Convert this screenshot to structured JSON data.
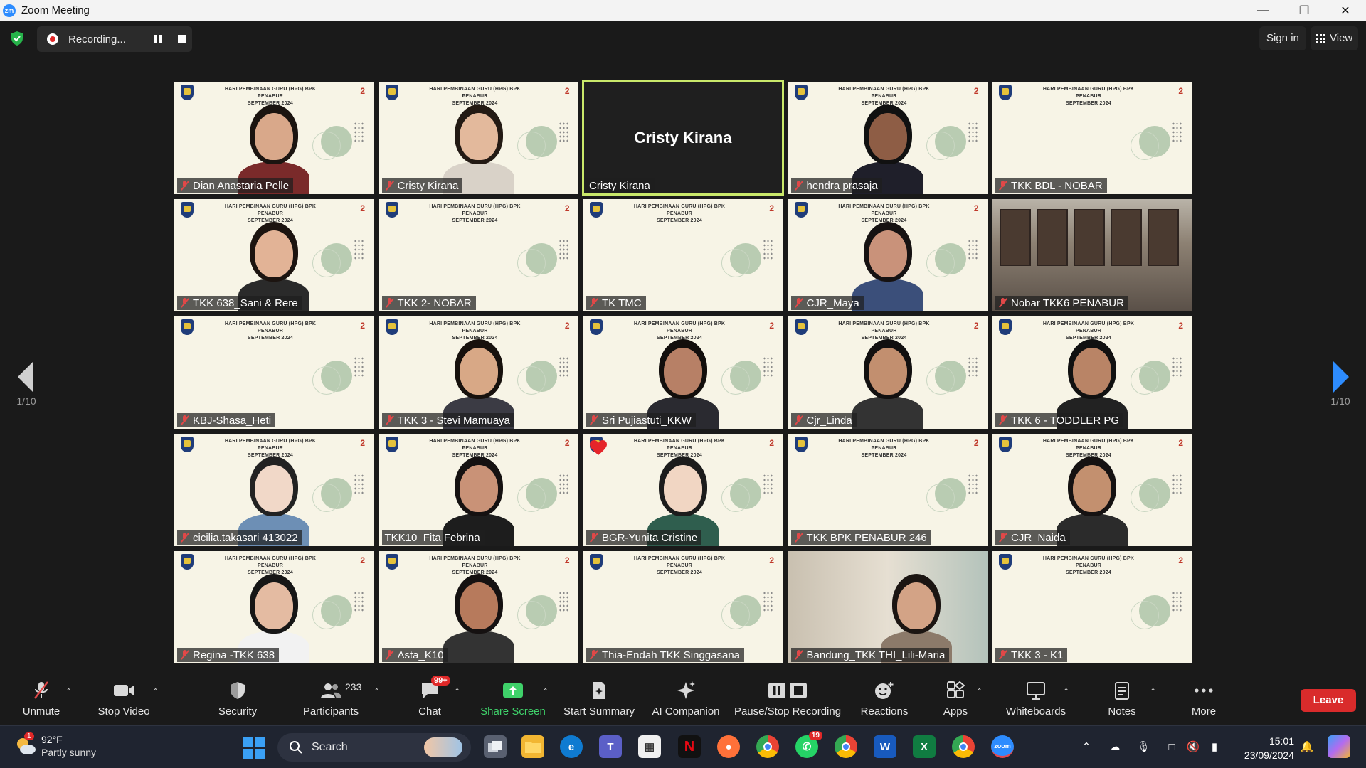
{
  "window": {
    "title": "Zoom Meeting",
    "app_icon_text": "zm"
  },
  "topbar": {
    "recording_label": "Recording...",
    "sign_in": "Sign in",
    "view": "View"
  },
  "pagination": {
    "left": "1/10",
    "right": "1/10"
  },
  "slide": {
    "title_line1": "HARI PEMBINAAN GURU (HPG) BPK PENABUR",
    "title_line2": "SEPTEMBER 2024",
    "logo": "2"
  },
  "participants": [
    {
      "name": "Dian Anastaria Pelle",
      "muted": true,
      "kind": "person",
      "skin": "#d9a88a",
      "hair": "#1b1410",
      "shirt": "#7a2a2a"
    },
    {
      "name": "Cristy Kirana",
      "muted": true,
      "kind": "person",
      "skin": "#e3b99c",
      "hair": "#231a14",
      "shirt": "#d9d2c8"
    },
    {
      "name": "Cristy Kirana",
      "muted": false,
      "kind": "noVideo",
      "big": "Cristy Kirana"
    },
    {
      "name": "hendra prasaja",
      "muted": true,
      "kind": "person",
      "skin": "#8e5d45",
      "hair": "#111111",
      "shirt": "#1f1f2a"
    },
    {
      "name": "TKK BDL - NOBAR",
      "muted": true,
      "kind": "slide"
    },
    {
      "name": "TKK 638_Sani & Rere",
      "muted": true,
      "kind": "person",
      "skin": "#e2b396",
      "hair": "#1c1410",
      "shirt": "#2a2a2a"
    },
    {
      "name": "TKK 2- NOBAR",
      "muted": true,
      "kind": "slide"
    },
    {
      "name": "TK TMC",
      "muted": true,
      "kind": "slide"
    },
    {
      "name": "CJR_Maya",
      "muted": true,
      "kind": "person",
      "skin": "#c9927a",
      "hair": "#161212",
      "shirt": "#3b4f7a"
    },
    {
      "name": "Nobar TKK6 PENABUR",
      "muted": true,
      "kind": "room"
    },
    {
      "name": "KBJ-Shasa_Heti",
      "muted": true,
      "kind": "slide"
    },
    {
      "name": "TKK 3 - Stevi Mamuaya",
      "muted": true,
      "kind": "person",
      "skin": "#d8a886",
      "hair": "#17110d",
      "shirt": "#3b3b44"
    },
    {
      "name": "Sri Pujiastuti_KKW",
      "muted": true,
      "kind": "person",
      "skin": "#b78066",
      "hair": "#120e0c",
      "shirt": "#2a2a30"
    },
    {
      "name": "Cjr_Linda",
      "muted": true,
      "kind": "person",
      "skin": "#c28f6f",
      "hair": "#121010",
      "shirt": "#333333"
    },
    {
      "name": "TKK 6 - TODDLER PG",
      "muted": true,
      "kind": "person",
      "skin": "#b98466",
      "hair": "#111111",
      "shirt": "#222222"
    },
    {
      "name": "cicilia.takasari 413022",
      "muted": true,
      "kind": "avatar",
      "skin": "#f1d8c8",
      "hair": "#222222",
      "shirt": "#6d8fb5"
    },
    {
      "name": "TKK10_Fita Febrina",
      "muted": false,
      "kind": "person",
      "skin": "#c99277",
      "hair": "#151111",
      "shirt": "#1d1d1d"
    },
    {
      "name": "BGR-Yunita Cristine",
      "muted": true,
      "kind": "avatar",
      "skin": "#f1d6c3",
      "hair": "#1c1c1c",
      "shirt": "#2f5e4e",
      "heart": true
    },
    {
      "name": "TKK BPK PENABUR 246",
      "muted": true,
      "kind": "slide"
    },
    {
      "name": "CJR_Naida",
      "muted": true,
      "kind": "person",
      "skin": "#c3906f",
      "hair": "#151212",
      "shirt": "#2b2b2b"
    },
    {
      "name": "Regina -TKK 638",
      "muted": true,
      "kind": "person",
      "skin": "#e4bba2",
      "hair": "#161616",
      "shirt": "#f2f2f2"
    },
    {
      "name": "Asta_K10",
      "muted": true,
      "kind": "person",
      "skin": "#b77a5c",
      "hair": "#151111",
      "shirt": "#333333"
    },
    {
      "name": "Thia-Endah TKK Singgasana",
      "muted": true,
      "kind": "slide"
    },
    {
      "name": "Bandung_TKK THI_Lili-Maria",
      "muted": true,
      "kind": "home",
      "skin": "#d3a386",
      "hair": "#1b1512",
      "shirt": "#8c7a6a"
    },
    {
      "name": "TKK 3 - K1",
      "muted": true,
      "kind": "slide"
    }
  ],
  "toolbar": {
    "unmute": "Unmute",
    "stop_video": "Stop Video",
    "security": "Security",
    "participants": "Participants",
    "participants_count": "233",
    "chat": "Chat",
    "chat_badge": "99+",
    "share_screen": "Share Screen",
    "start_summary": "Start Summary",
    "ai_companion": "AI Companion",
    "pause_stop_recording": "Pause/Stop Recording",
    "reactions": "Reactions",
    "apps": "Apps",
    "whiteboards": "Whiteboards",
    "notes": "Notes",
    "more": "More",
    "leave": "Leave"
  },
  "taskbar": {
    "weather_temp": "92°F",
    "weather_cond": "Partly sunny",
    "weather_badge": "1",
    "search": "Search",
    "whatsapp_badge": "19",
    "time": "15:01",
    "date": "23/09/2024"
  },
  "colors": {
    "accent_green": "#3fd16a",
    "leave_red": "#d92b2b",
    "active_speaker": "#c9e86a",
    "muted_red": "#e14848"
  }
}
